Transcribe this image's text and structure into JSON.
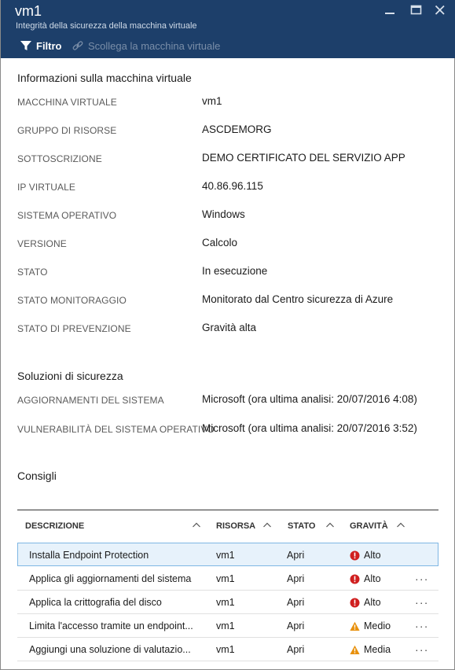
{
  "window": {
    "title": "vm1",
    "subtitle": "Integrità della sicurezza della macchina virtuale"
  },
  "toolbar": {
    "filter_label": "Filtro",
    "detach_label": "Scollega la macchina virtuale"
  },
  "vm_info": {
    "section_title": "Informazioni sulla macchina virtuale",
    "fields": [
      {
        "label": "MACCHINA VIRTUALE",
        "value": "vm1"
      },
      {
        "label": "GRUPPO DI RISORSE",
        "value": "ASCDEMORG"
      },
      {
        "label": "SOTTOSCRIZIONE",
        "value": "DEMO CERTIFICATO DEL SERVIZIO APP"
      },
      {
        "label": "IP VIRTUALE",
        "value": "40.86.96.115"
      },
      {
        "label": "SISTEMA OPERATIVO",
        "value": "Windows"
      },
      {
        "label": "VERSIONE",
        "value": "Calcolo"
      },
      {
        "label": "STATO",
        "value": "In esecuzione"
      },
      {
        "label": "STATO MONITORAGGIO",
        "value": "Monitorato dal Centro sicurezza di Azure"
      },
      {
        "label": "STATO DI PREVENZIONE",
        "value": "Gravità alta"
      }
    ]
  },
  "security_solutions": {
    "section_title": "Soluzioni di sicurezza",
    "fields": [
      {
        "label": "AGGIORNAMENTI DEL SISTEMA",
        "value": "Microsoft (ora ultima analisi: 20/07/2016 4:08)"
      },
      {
        "label": "VULNERABILITÀ DEL SISTEMA OPERATIVO",
        "value": "Microsoft (ora ultima analisi: 20/07/2016 3:52)"
      }
    ]
  },
  "recommendations": {
    "section_title": "Consigli",
    "columns": [
      "DESCRIZIONE",
      "RISORSA",
      "STATO",
      "GRAVITÀ"
    ],
    "rows": [
      {
        "description": "Installa Endpoint Protection",
        "resource": "vm1",
        "state": "Apri",
        "severity": "Alto",
        "level": "high",
        "selected": true
      },
      {
        "description": "Applica gli aggiornamenti del sistema",
        "resource": "vm1",
        "state": "Apri",
        "severity": "Alto",
        "level": "high",
        "more": "..."
      },
      {
        "description": "Applica la crittografia del disco",
        "resource": "vm1",
        "state": "Apri",
        "severity": "Alto",
        "level": "high",
        "more": "..."
      },
      {
        "description": "Limita l'accesso tramite un endpoint...",
        "resource": "vm1",
        "state": "Apri",
        "severity": "Medio",
        "level": "medium",
        "more": "..."
      },
      {
        "description": "Aggiungi una soluzione di valutazio...",
        "resource": "vm1",
        "state": "Apri",
        "severity": "Media",
        "level": "medium",
        "more": "..."
      }
    ]
  },
  "colors": {
    "header_bg": "#1d3f6a",
    "high": "#d01f1f",
    "medium": "#e8900c",
    "selected_row": "#e7f2fb"
  },
  "icons": {
    "filter": "filter-icon",
    "detach": "link-icon",
    "minimize": "minimize-icon",
    "maximize": "maximize-icon",
    "close": "close-icon",
    "high": "error-circle-icon",
    "medium": "warning-triangle-icon"
  }
}
